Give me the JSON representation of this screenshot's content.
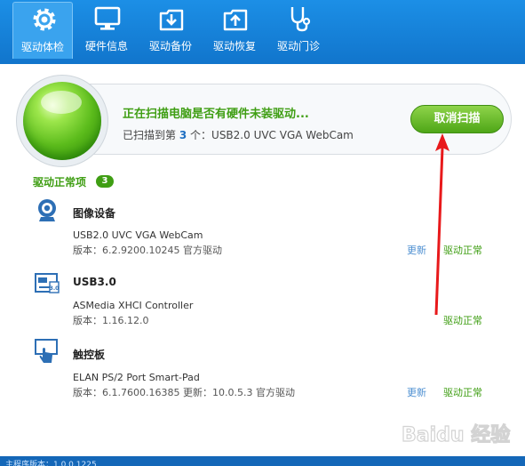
{
  "toolbar": {
    "items": [
      {
        "label": "驱动体检",
        "icon": "gear-icon"
      },
      {
        "label": "硬件信息",
        "icon": "monitor-icon"
      },
      {
        "label": "驱动备份",
        "icon": "backup-icon"
      },
      {
        "label": "驱动恢复",
        "icon": "restore-icon"
      },
      {
        "label": "驱动门诊",
        "icon": "stethoscope-icon"
      }
    ]
  },
  "scan": {
    "title": "正在扫描电脑是否有硬件未装驱动...",
    "status_prefix": "已扫描到第",
    "status_count": "3",
    "status_suffix": "个：USB2.0 UVC VGA WebCam",
    "cancel_label": "取消扫描"
  },
  "section": {
    "title": "驱动正常项",
    "badge": "3"
  },
  "devices": [
    {
      "category": "图像设备",
      "icon": "webcam-icon",
      "name": "USB2.0 UVC VGA WebCam",
      "version": "版本：6.2.9200.10245 官方驱动",
      "update_label": "更新",
      "status": "驱动正常"
    },
    {
      "category": "USB3.0",
      "icon": "usb-icon",
      "name": "ASMedia XHCI Controller",
      "version": "版本：1.16.12.0",
      "status": "驱动正常"
    },
    {
      "category": "触控板",
      "icon": "touchpad-icon",
      "name": "ELAN PS/2 Port Smart-Pad",
      "version": "版本：6.1.7600.16385 更新：10.0.5.3 官方驱动",
      "update_label": "更新",
      "status": "驱动正常"
    }
  ],
  "footer": {
    "version_text": "主程序版本：1.0.0.1225"
  },
  "watermark": {
    "text": "Baidu 经验"
  },
  "colors": {
    "toolbar": "#1175cc",
    "accent_green": "#3f9e13",
    "link_blue": "#4d8fd1",
    "annotation_red": "#e8191b"
  }
}
